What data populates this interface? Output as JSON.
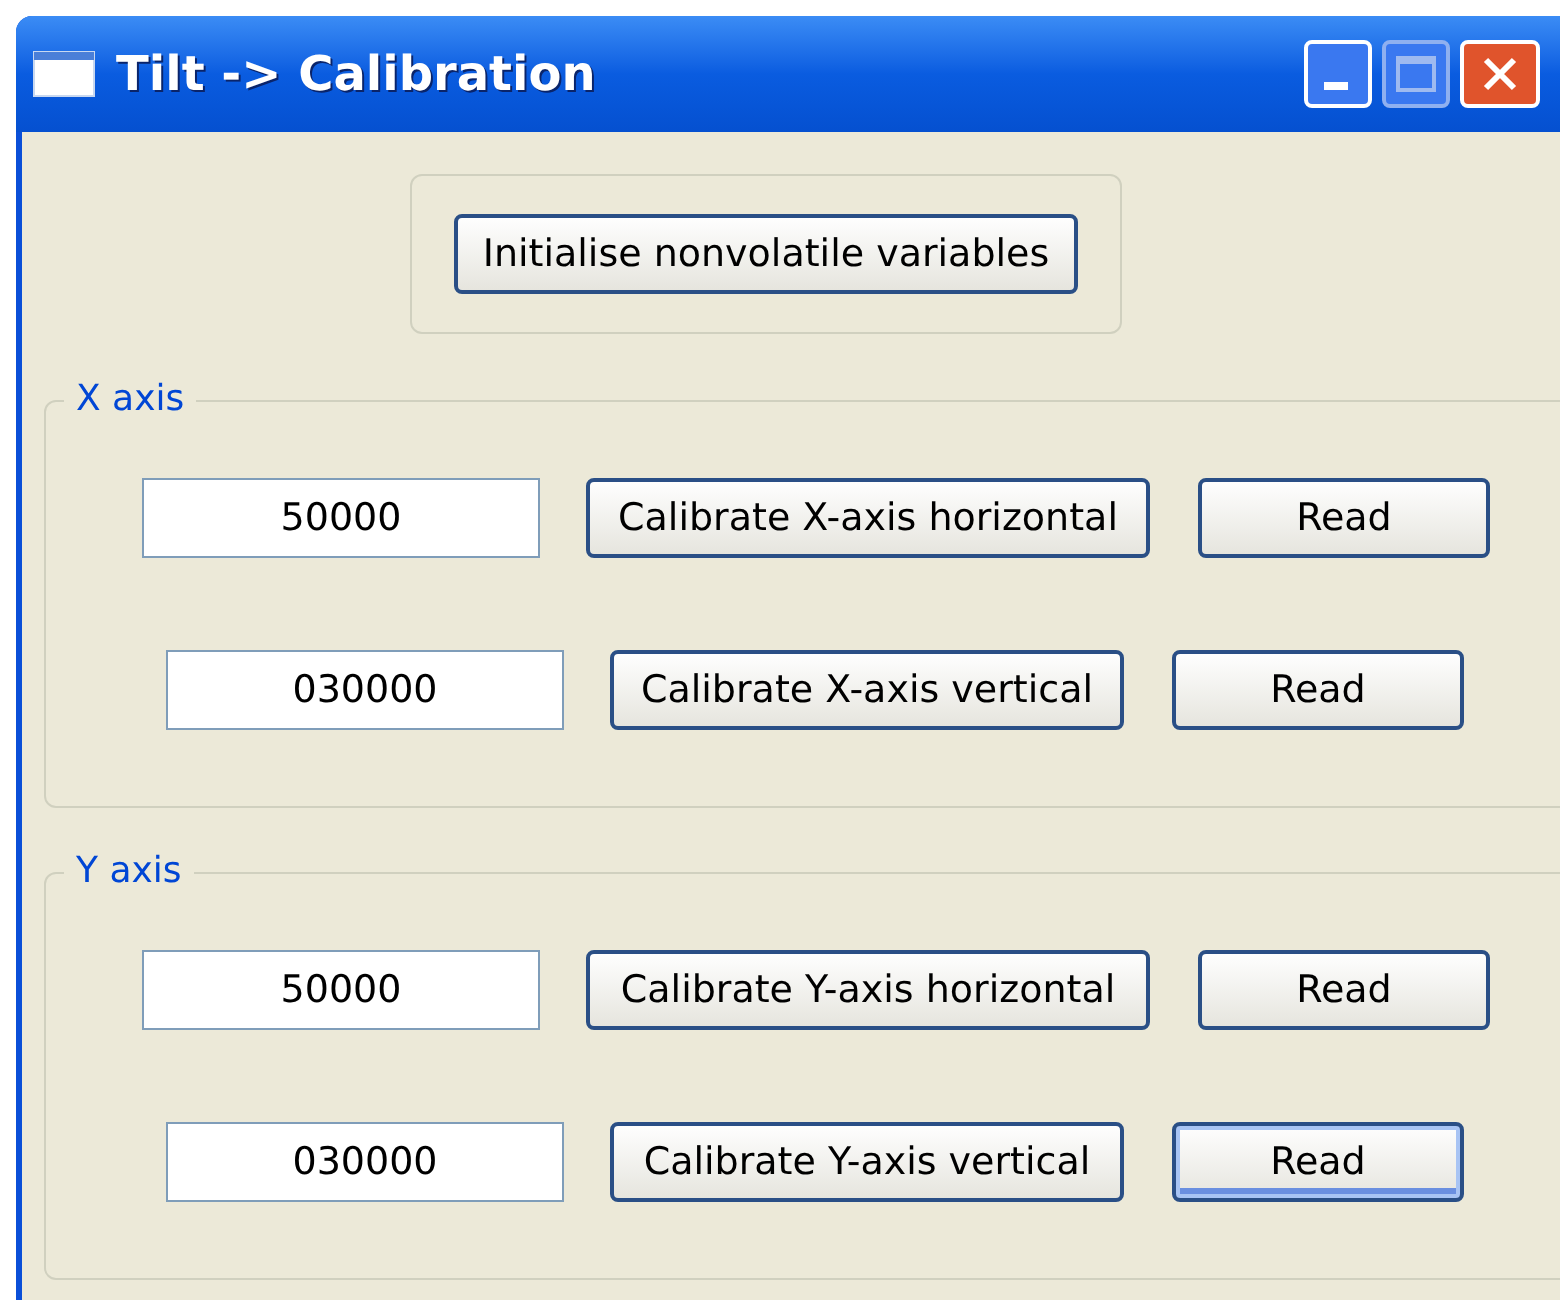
{
  "window": {
    "title": "Tilt -> Calibration"
  },
  "init_button": {
    "label": "Initialise nonvolatile variables",
    "focused": false
  },
  "groups": [
    {
      "title": "X axis",
      "rows": [
        {
          "value": "50000",
          "button": {
            "label": "Calibrate X-axis horizontal",
            "focused": false
          },
          "read": {
            "label": "Read",
            "focused": false
          }
        },
        {
          "value": "030000",
          "button": {
            "label": "Calibrate X-axis vertical",
            "focused": false
          },
          "read": {
            "label": "Read",
            "focused": false
          }
        }
      ]
    },
    {
      "title": "Y axis",
      "rows": [
        {
          "value": "50000",
          "button": {
            "label": "Calibrate Y-axis horizontal",
            "focused": false
          },
          "read": {
            "label": "Read",
            "focused": false
          }
        },
        {
          "value": "030000",
          "button": {
            "label": "Calibrate Y-axis vertical",
            "focused": false
          },
          "read": {
            "label": "Read",
            "focused": true
          }
        }
      ]
    }
  ]
}
